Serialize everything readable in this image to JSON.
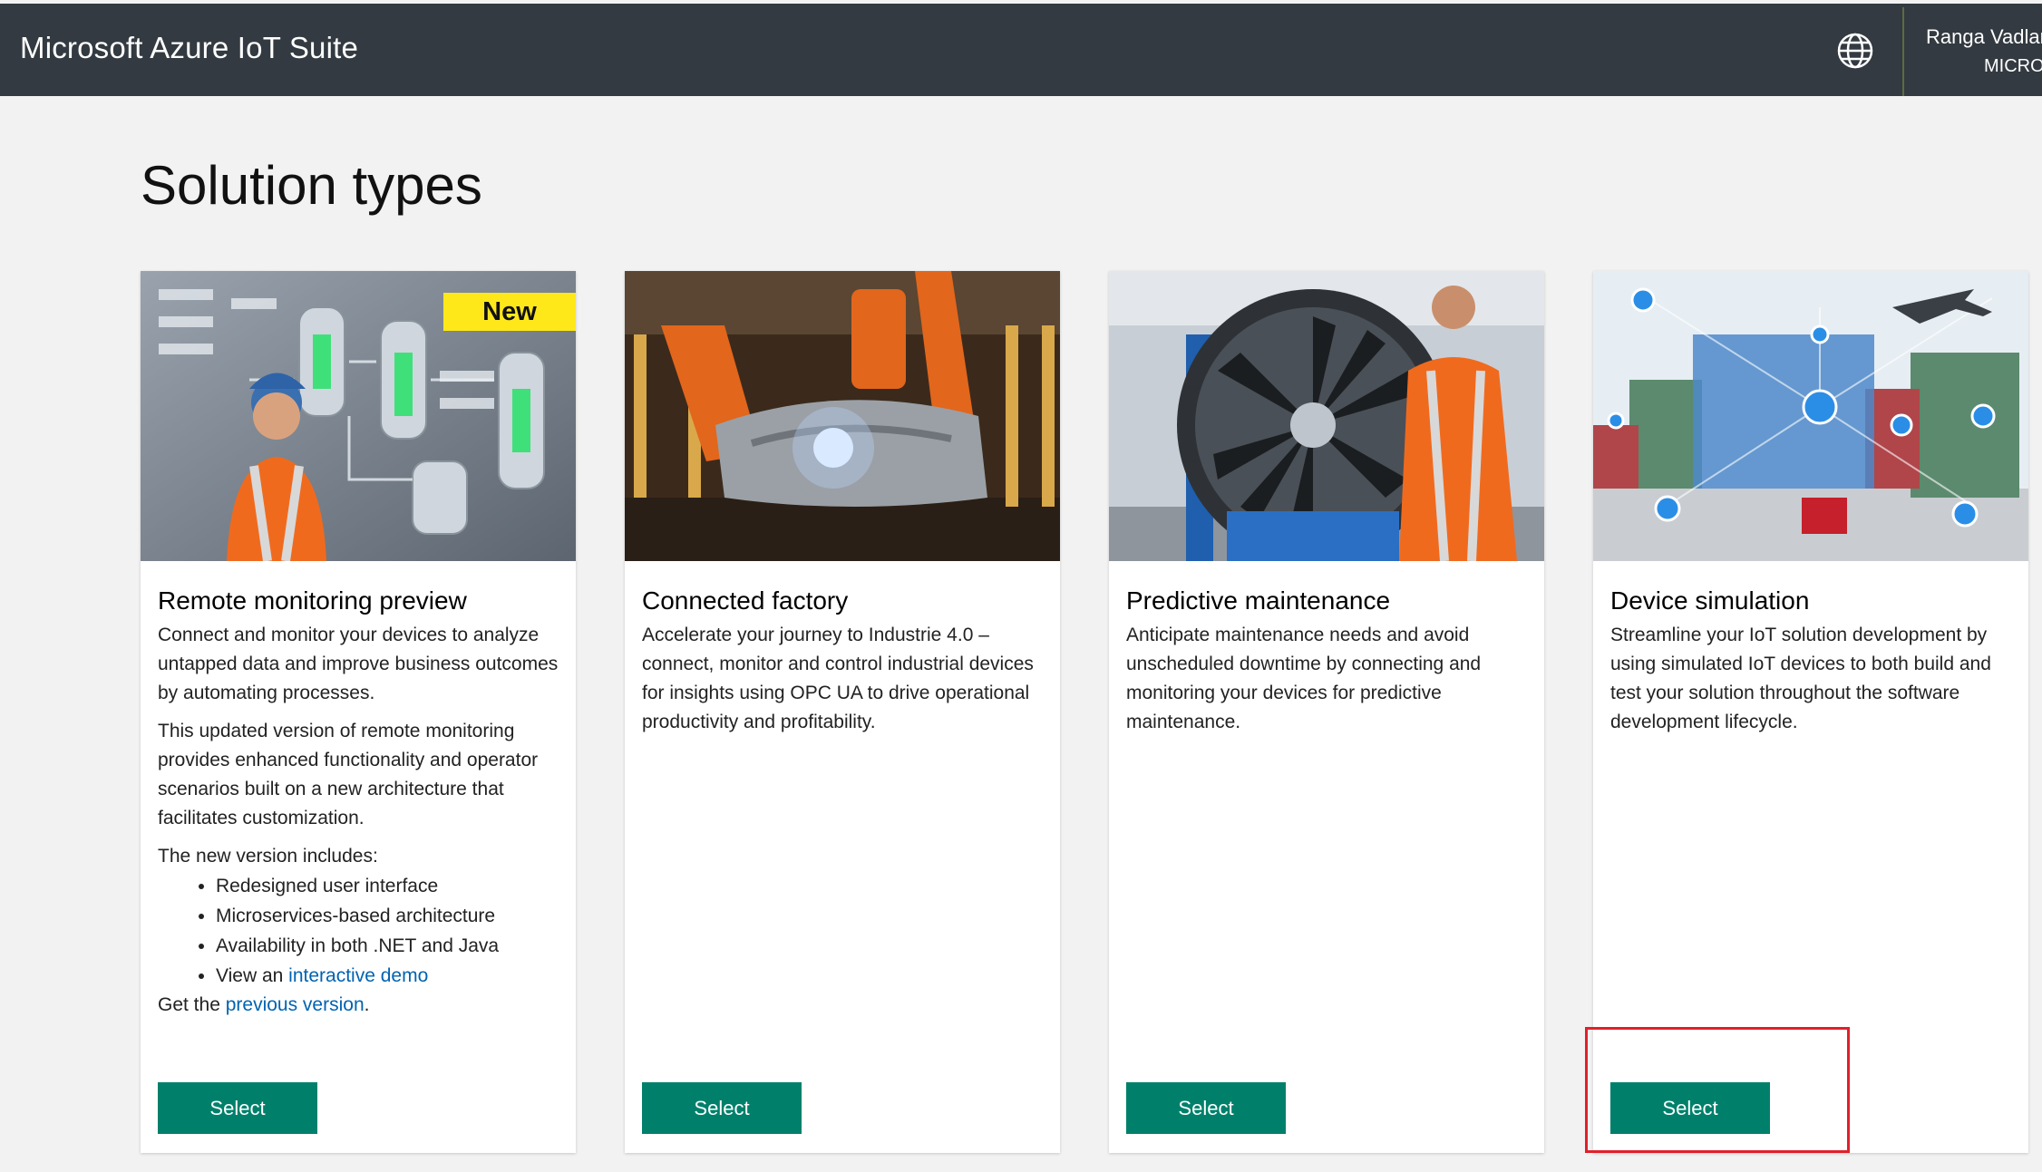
{
  "header": {
    "app_title": "Microsoft Azure IoT Suite",
    "user_name": "Ranga Vadlar",
    "user_org": "MICRO"
  },
  "page_title": "Solution types",
  "cards": [
    {
      "title": "Remote monitoring preview",
      "badge": "New",
      "description": "Connect and monitor your devices to analyze untapped data and improve business outcomes by automating processes.",
      "description2": "This updated version of remote monitoring provides enhanced functionality and operator scenarios built on a new architecture that facilitates customization.",
      "includes_label": "The new version includes:",
      "features": [
        "Redesigned user interface",
        "Microservices-based architecture",
        "Availability in both .NET and Java"
      ],
      "demo_prefix": "View an ",
      "demo_link": "interactive demo",
      "prev_prefix": "Get the ",
      "prev_link": "previous version",
      "prev_suffix": ".",
      "select_label": "Select"
    },
    {
      "title": "Connected factory",
      "description": "Accelerate your journey to Industrie 4.0 – connect, monitor and control industrial devices for insights using OPC UA to drive operational productivity and profitability.",
      "select_label": "Select"
    },
    {
      "title": "Predictive maintenance",
      "description": "Anticipate maintenance needs and avoid unscheduled downtime by connecting and monitoring your devices for predictive maintenance.",
      "select_label": "Select"
    },
    {
      "title": "Device simulation",
      "description": "Streamline your IoT solution development by using simulated IoT devices to both build and test your solution throughout the software development lifecycle.",
      "select_label": "Select"
    }
  ],
  "colors": {
    "header_bg": "#333a41",
    "select_button": "#00806b",
    "link": "#0063b1",
    "badge": "#ffe81a",
    "highlight": "#e0202b"
  },
  "icons": {
    "language": "globe-icon"
  }
}
